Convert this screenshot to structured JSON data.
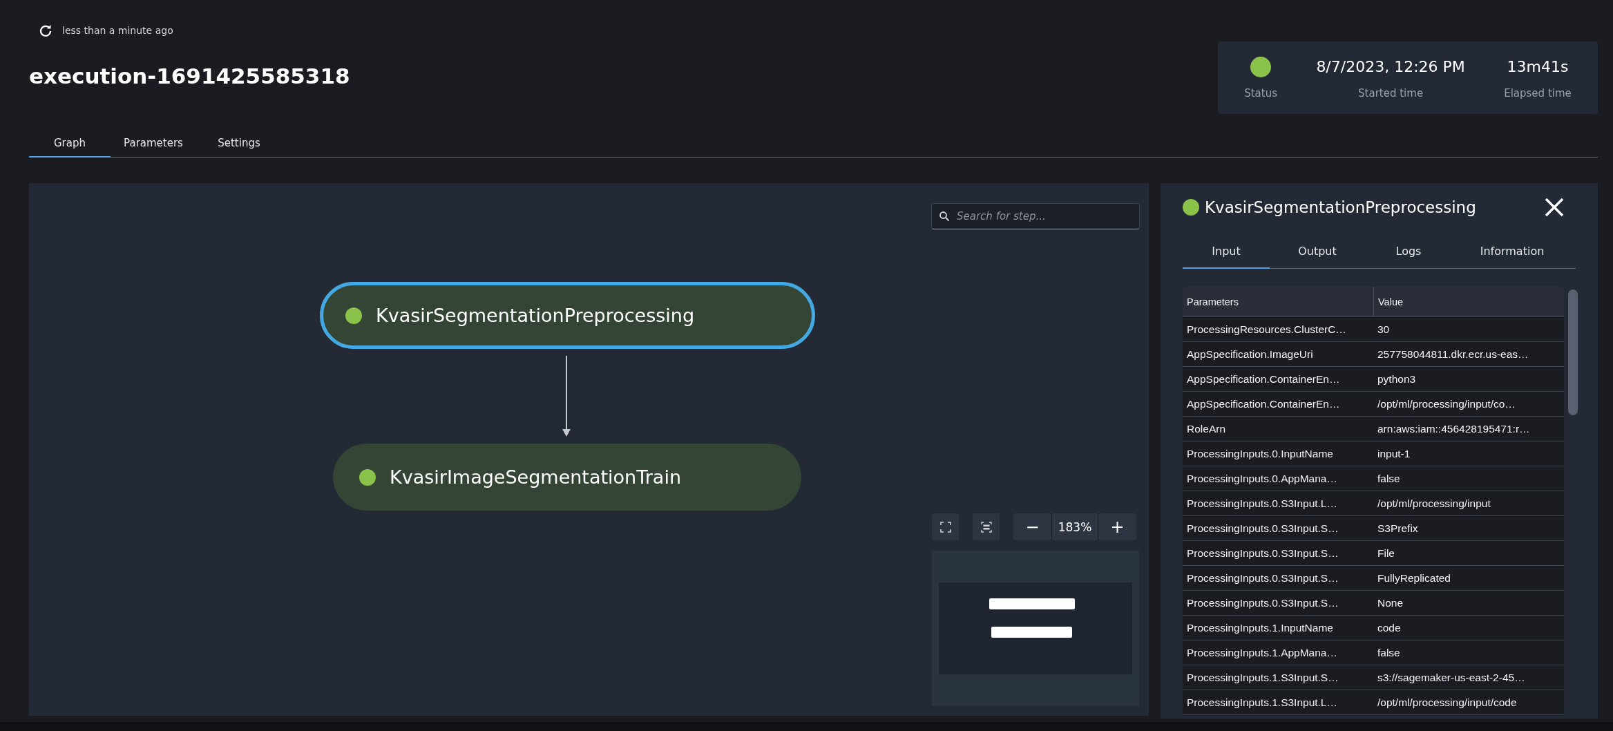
{
  "refresh": {
    "label": "less than a minute ago"
  },
  "title": "execution-1691425585318",
  "summary": {
    "color": "#8bc34a",
    "status_label": "Status",
    "started": "8/7/2023, 12:26 PM",
    "started_label": "Started time",
    "elapsed": "13m41s",
    "elapsed_label": "Elapsed time"
  },
  "tabs": [
    {
      "label": "Graph",
      "selected": true
    },
    {
      "label": "Parameters",
      "selected": false
    },
    {
      "label": "Settings",
      "selected": false
    }
  ],
  "graph": {
    "search": {
      "placeholder": "Search for step..."
    },
    "nodes": [
      {
        "label": "KvasirSegmentationPreprocessing",
        "color": "#8bc34a",
        "selected": true
      },
      {
        "label": "KvasirImageSegmentationTrain",
        "color": "#8bc34a",
        "selected": false
      }
    ],
    "zoom": {
      "minus": "−",
      "value": "183%",
      "plus": "+"
    }
  },
  "details": {
    "title": "KvasirSegmentationPreprocessing",
    "color": "#8bc34a",
    "tabs": [
      {
        "label": "Input",
        "selected": true
      },
      {
        "label": "Output",
        "selected": false
      },
      {
        "label": "Logs",
        "selected": false
      },
      {
        "label": "Information",
        "selected": false
      }
    ],
    "table": {
      "columns": [
        "Parameters",
        "Value"
      ],
      "rows": [
        [
          "ProcessingResources.ClusterC…",
          "30"
        ],
        [
          "AppSpecification.ImageUri",
          "257758044811.dkr.ecr.us-eas…"
        ],
        [
          "AppSpecification.ContainerEn…",
          "python3"
        ],
        [
          "AppSpecification.ContainerEn…",
          "/opt/ml/processing/input/co…"
        ],
        [
          "RoleArn",
          "arn:aws:iam::456428195471:r…"
        ],
        [
          "ProcessingInputs.0.InputName",
          "input-1"
        ],
        [
          "ProcessingInputs.0.AppMana…",
          "false"
        ],
        [
          "ProcessingInputs.0.S3Input.L…",
          "/opt/ml/processing/input"
        ],
        [
          "ProcessingInputs.0.S3Input.S…",
          "S3Prefix"
        ],
        [
          "ProcessingInputs.0.S3Input.S…",
          "File"
        ],
        [
          "ProcessingInputs.0.S3Input.S…",
          "FullyReplicated"
        ],
        [
          "ProcessingInputs.0.S3Input.S…",
          "None"
        ],
        [
          "ProcessingInputs.1.InputName",
          "code"
        ],
        [
          "ProcessingInputs.1.AppMana…",
          "false"
        ],
        [
          "ProcessingInputs.1.S3Input.S…",
          "s3://sagemaker-us-east-2-45…"
        ],
        [
          "ProcessingInputs.1.S3Input.L…",
          "/opt/ml/processing/input/code"
        ]
      ]
    }
  }
}
